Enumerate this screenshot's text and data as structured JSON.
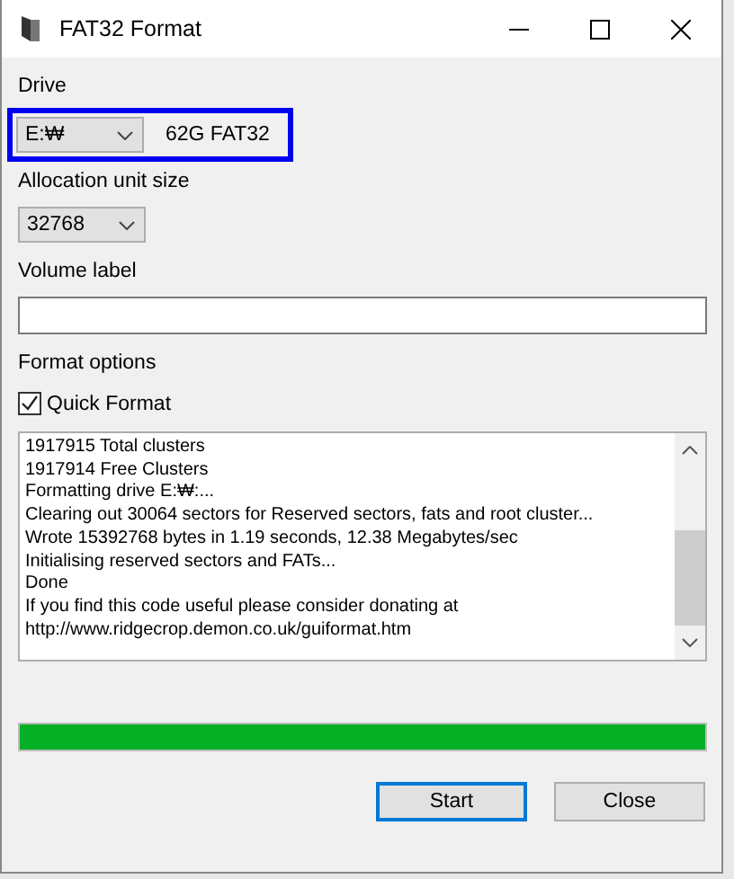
{
  "window": {
    "title": "FAT32 Format"
  },
  "drive": {
    "label": "Drive",
    "value": "E:₩",
    "info": "62G FAT32",
    "highlighted": true
  },
  "allocation": {
    "label": "Allocation unit size",
    "value": "32768"
  },
  "volume_label": {
    "label": "Volume label"
  },
  "format_options": {
    "label": "Format options",
    "quick_format": {
      "label": "Quick Format",
      "checked": true
    }
  },
  "log": [
    "1917915 Total clusters",
    "1917914 Free Clusters",
    "Formatting drive E:₩:...",
    "Clearing out 30064 sectors for Reserved sectors, fats and root cluster...",
    "Wrote 15392768 bytes in 1.19 seconds, 12.38 Megabytes/sec",
    "Initialising reserved sectors and FATs...",
    "Done",
    "If you find this code useful please consider donating at",
    "http://www.ridgecrop.demon.co.uk/guiformat.htm"
  ],
  "progress": {
    "level": 1
  },
  "buttons": [
    {
      "label": "Start",
      "focused": true
    },
    {
      "label": "Close",
      "focused": false
    }
  ]
}
